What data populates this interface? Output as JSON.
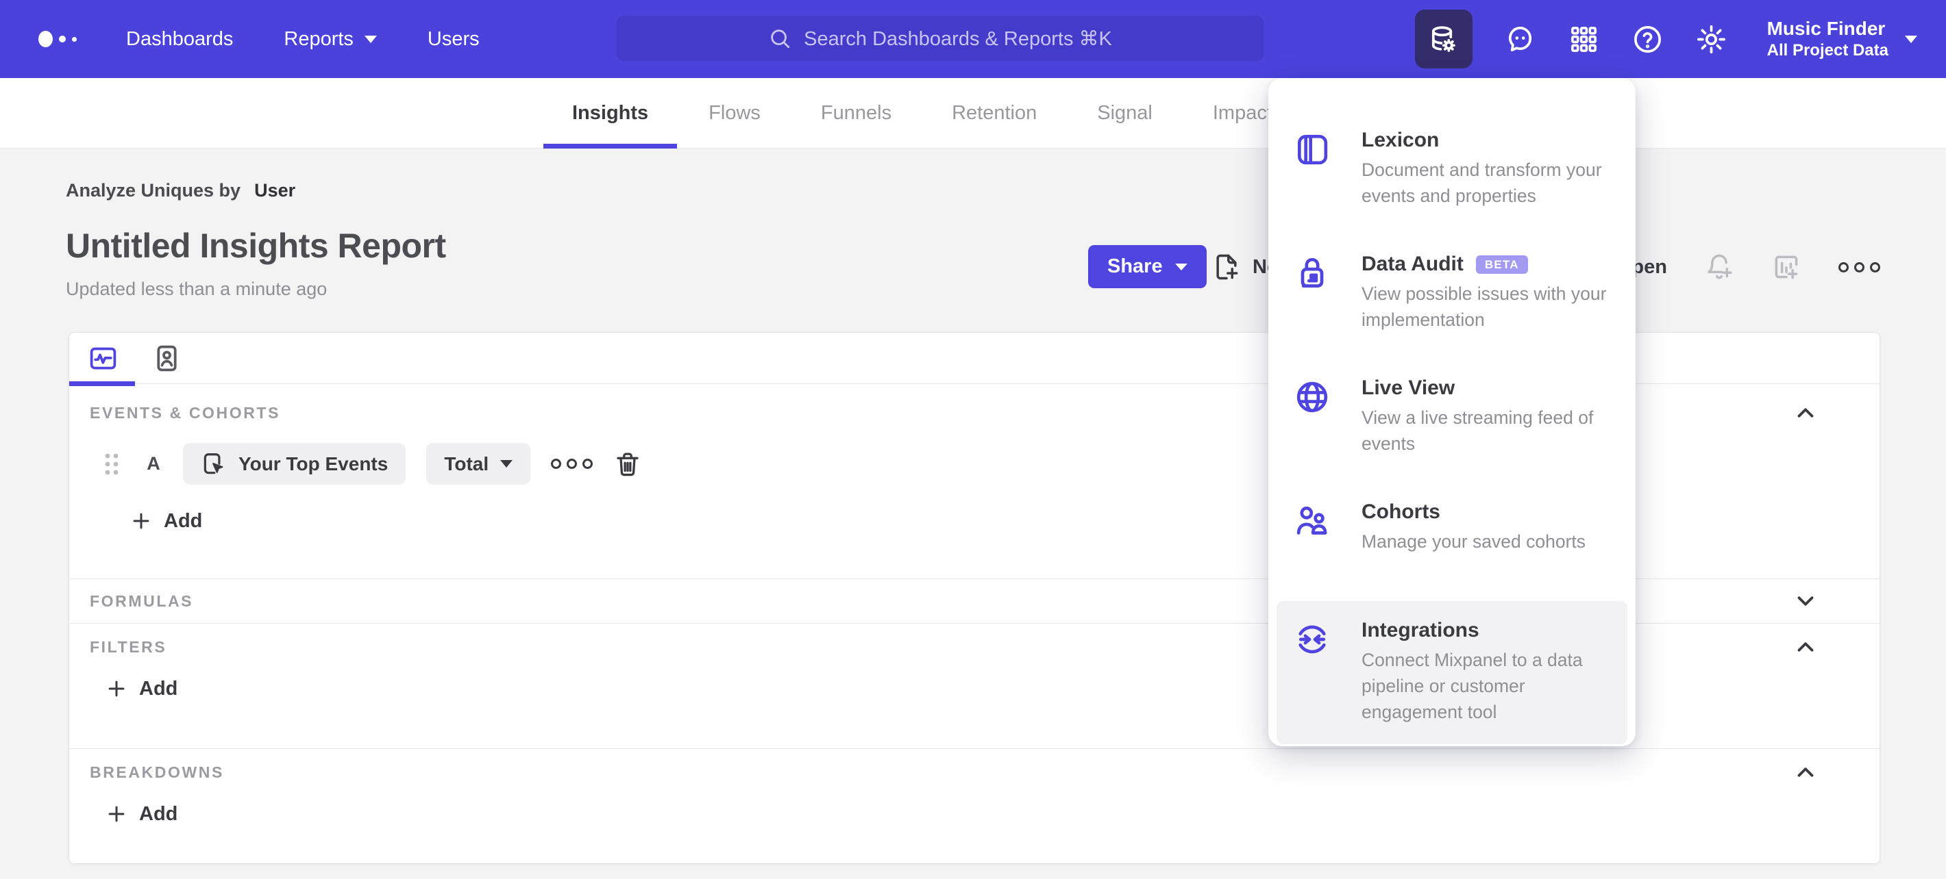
{
  "nav": {
    "items": [
      {
        "label": "Dashboards"
      },
      {
        "label": "Reports"
      },
      {
        "label": "Users"
      }
    ]
  },
  "search": {
    "placeholder": "Search Dashboards & Reports ⌘K"
  },
  "project": {
    "name": "Music Finder",
    "scope": "All Project Data"
  },
  "report_tabs": {
    "items": [
      "Insights",
      "Flows",
      "Funnels",
      "Retention",
      "Signal",
      "Impact"
    ],
    "active": "Insights"
  },
  "header": {
    "breadcrumb_label": "Analyze Uniques by",
    "breadcrumb_value": "User",
    "title": "Untitled Insights Report",
    "updated": "Updated less than a minute ago",
    "share_label": "Share",
    "new_label": "New",
    "open_label": "Open"
  },
  "builder": {
    "events": {
      "label": "EVENTS & COHORTS",
      "row_letter": "A",
      "event_name": "Your Top Events",
      "aggregation": "Total",
      "add_label": "Add"
    },
    "formulas": {
      "label": "FORMULAS"
    },
    "filters": {
      "label": "FILTERS",
      "add_label": "Add"
    },
    "breakdowns": {
      "label": "BREAKDOWNS",
      "add_label": "Add"
    }
  },
  "tools_menu": {
    "items": [
      {
        "title": "Lexicon",
        "description": "Document and transform your events and properties"
      },
      {
        "title": "Data Audit",
        "badge": "BETA",
        "description": "View possible issues with your implementation"
      },
      {
        "title": "Live View",
        "description": "View a live streaming feed of events"
      },
      {
        "title": "Cohorts",
        "description": "Manage your saved cohorts"
      },
      {
        "title": "Integrations",
        "description": "Connect Mixpanel to a data pipeline or customer engagement tool"
      }
    ]
  },
  "icons": [
    "mixpanel-logo",
    "search",
    "data-management",
    "feedback",
    "apps-grid",
    "help",
    "settings",
    "caret-down",
    "document-plus",
    "folder-open",
    "bell-plus",
    "chart-plus",
    "more",
    "insights-chart",
    "profile-card",
    "drag-handle",
    "event-click",
    "trash",
    "plus",
    "chevron-up",
    "chevron-down",
    "lexicon-book",
    "audit-lock",
    "globe",
    "cohorts-people",
    "integrations-sync"
  ],
  "colors": {
    "nav_bg": "#4b42dc",
    "search_bg": "#443bcb",
    "selected_icon_bg": "#332d6b",
    "accent": "#4f44e0",
    "beta_badge": "#a29af0",
    "page_bg": "#f3f3f4"
  }
}
